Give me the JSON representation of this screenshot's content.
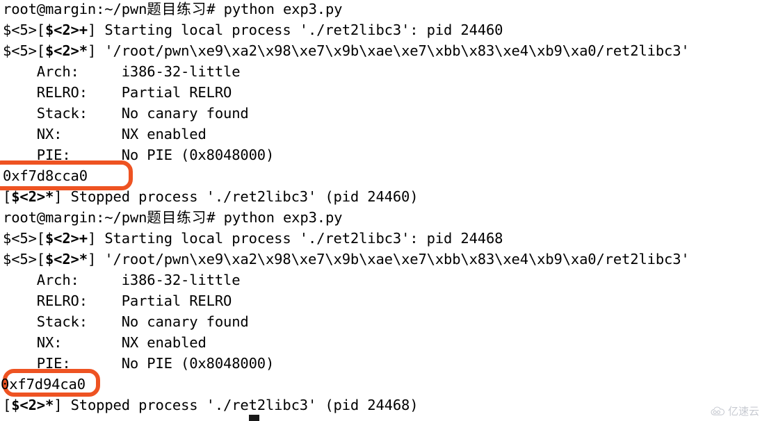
{
  "terminal": {
    "background_color": "#ffffff",
    "text_color": "#000000",
    "highlight_color": "#ee5322",
    "lines": [
      {
        "id": "l01",
        "text": "root@margin:~/pwn题目练习# python exp3.py"
      },
      {
        "id": "l02",
        "text": "$<5>[$<2>+] Starting local process './ret2libc3': pid 24460"
      },
      {
        "id": "l03",
        "text": "$<5>[$<2>*] '/root/pwn\\xe9\\xa2\\x98\\xe7\\x9b\\xae\\xe7\\xbb\\x83\\xe4\\xb9\\xa0/ret2libc3'"
      },
      {
        "id": "l04",
        "text": "    Arch:     i386-32-little"
      },
      {
        "id": "l05",
        "text": "    RELRO:    Partial RELRO"
      },
      {
        "id": "l06",
        "text": "    Stack:    No canary found"
      },
      {
        "id": "l07",
        "text": "    NX:       NX enabled"
      },
      {
        "id": "l08",
        "text": "    PIE:      No PIE (0x8048000)"
      },
      {
        "id": "l09",
        "text": "0xf7d8cca0"
      },
      {
        "id": "l10",
        "text": "[$<2>*] Stopped process './ret2libc3' (pid 24460)"
      },
      {
        "id": "l11",
        "text": "root@margin:~/pwn题目练习# python exp3.py"
      },
      {
        "id": "l12",
        "text": "$<5>[$<2>+] Starting local process './ret2libc3': pid 24468"
      },
      {
        "id": "l13",
        "text": "$<5>[$<2>*] '/root/pwn\\xe9\\xa2\\x98\\xe7\\x9b\\xae\\xe7\\xbb\\x83\\xe4\\xb9\\xa0/ret2libc3'"
      },
      {
        "id": "l14",
        "text": "    Arch:     i386-32-little"
      },
      {
        "id": "l15",
        "text": "    RELRO:    Partial RELRO"
      },
      {
        "id": "l16",
        "text": "    Stack:    No canary found"
      },
      {
        "id": "l17",
        "text": "    NX:       NX enabled"
      },
      {
        "id": "l18",
        "text": "    PIE:      No PIE (0x8048000)"
      },
      {
        "id": "l19",
        "text": "0xf7d94ca0"
      },
      {
        "id": "l20",
        "text": "[$<2>*] Stopped process './ret2libc3' (pid 24468)"
      }
    ],
    "segments": {
      "prompt_user_host_path": "root@margin:~/pwn",
      "prompt_cjk": "题目练习",
      "prompt_tail": "# python exp3.py",
      "log_prefix_5": "$<5>[",
      "log_badge_2": "$<2>",
      "log_status_plus": "+",
      "log_status_star": "*",
      "log_bracket_close": "] ",
      "start_msg_1": "Starting local process './ret2libc3': pid 24460",
      "start_msg_2": "Starting local process './ret2libc3': pid 24468",
      "path_msg": "'/root/pwn\\xe9\\xa2\\x98\\xe7\\x9b\\xae\\xe7\\xbb\\x83\\xe4\\xb9\\xa0/ret2libc3'",
      "stop_prefix": "[",
      "stop_msg_1": "] Stopped process './ret2libc3' (pid 24460)",
      "stop_msg_2": "] Stopped process './ret2libc3' (pid 24468)",
      "checksec": {
        "arch_label": "    Arch:",
        "arch_value": "i386-32-little",
        "relro_label": "    RELRO:",
        "relro_value": "Partial RELRO",
        "stack_label": "    Stack:",
        "stack_value": "No canary found",
        "nx_label": "    NX:",
        "nx_value": "NX enabled",
        "pie_label": "    PIE:",
        "pie_value": "No PIE (0x8048000)"
      },
      "leaked_address_1": "0xf7d8cca0",
      "leaked_address_2": "0xf7d94ca0"
    }
  },
  "watermark": {
    "text": "亿速云",
    "icon": "cloud-icon",
    "color": "#9aa0ad"
  }
}
